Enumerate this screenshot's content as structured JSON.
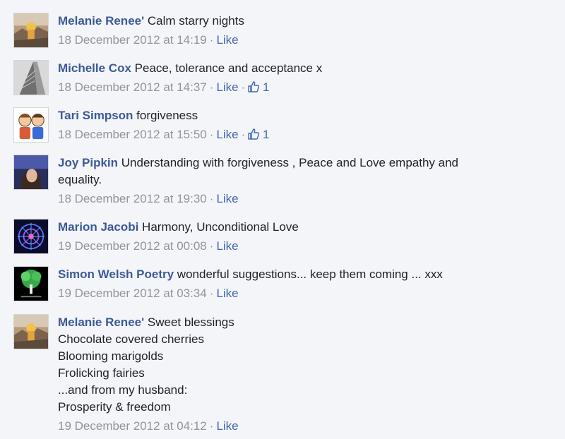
{
  "comments": [
    {
      "author": "Melanie Renee'",
      "text": "Calm starry nights",
      "timestamp": "18 December 2012 at 14:19",
      "like_label": "Like",
      "avatar_icon": "sunset-rocks-photo"
    },
    {
      "author": "Michelle Cox",
      "text": "Peace, tolerance and acceptance x",
      "timestamp": "18 December 2012 at 14:37",
      "like_label": "Like",
      "like_count": "1",
      "avatar_icon": "skyscraper-photo"
    },
    {
      "author": "Tari Simpson",
      "text": "forgiveness",
      "timestamp": "18 December 2012 at 15:50",
      "like_label": "Like",
      "like_count": "1",
      "avatar_icon": "cartoon-couple-photo"
    },
    {
      "author": "Joy Pipkin",
      "text": "Understanding with forgiveness , Peace and Love empathy and",
      "text_cont": "equality.",
      "timestamp": "18 December 2012 at 19:30",
      "like_label": "Like",
      "avatar_icon": "portrait-photo"
    },
    {
      "author": "Marion Jacobi",
      "text": "Harmony, Unconditional Love",
      "timestamp": "19 December 2012 at 00:08",
      "like_label": "Like",
      "avatar_icon": "mandala-photo"
    },
    {
      "author": "Simon Welsh Poetry",
      "text": "wonderful suggestions... keep them coming ... xxx",
      "timestamp": "19 December 2012 at 03:34",
      "like_label": "Like",
      "avatar_icon": "glowing-tree-photo"
    },
    {
      "author": "Melanie Renee'",
      "text": "Sweet blessings",
      "lines": [
        "Chocolate covered cherries",
        "Blooming marigolds",
        "Frolicking fairies",
        "...and from my husband:",
        "Prosperity & freedom"
      ],
      "timestamp": "19 December 2012 at 04:12",
      "like_label": "Like",
      "avatar_icon": "sunset-rocks-photo"
    }
  ],
  "separator": "·",
  "colors": {
    "author": "#3b5998",
    "link": "#4267b2",
    "meta": "#90949c",
    "background": "#f4f5f8"
  }
}
